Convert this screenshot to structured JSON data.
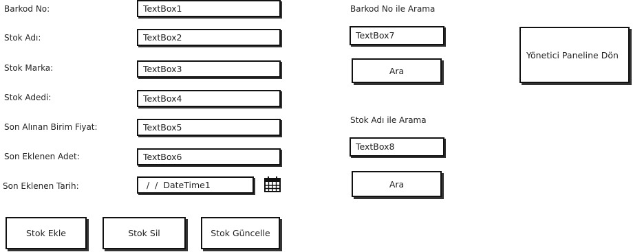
{
  "form": {
    "barkod_label": "Barkod No:",
    "barkod_value": "TextBox1",
    "stok_adi_label": "Stok Adı:",
    "stok_adi_value": "TextBox2",
    "stok_marka_label": "Stok Marka:",
    "stok_marka_value": "TextBox3",
    "stok_adedi_label": "Stok Adedi:",
    "stok_adedi_value": "TextBox4",
    "birim_fiyat_label": "Son Alınan Birim Fiyat:",
    "birim_fiyat_value": "TextBox5",
    "eklenen_adet_label": "Son Eklenen Adet:",
    "eklenen_adet_value": "TextBox6",
    "eklenen_tarih_label": "Son Eklenen Tarih:",
    "eklenen_tarih_value": "/ /    DateTime1"
  },
  "actions": {
    "add": "Stok Ekle",
    "delete": "Stok Sil",
    "update": "Stok Güncelle"
  },
  "search_barkod": {
    "title": "Barkod No ile Arama",
    "value": "TextBox7",
    "button": "Ara"
  },
  "search_name": {
    "title": "Stok Adı ile Arama",
    "value": "TextBox8",
    "button": "Ara"
  },
  "admin_panel_button": "Yönetici Paneline Dön",
  "icons": {
    "date_picker": "calendar-icon"
  }
}
